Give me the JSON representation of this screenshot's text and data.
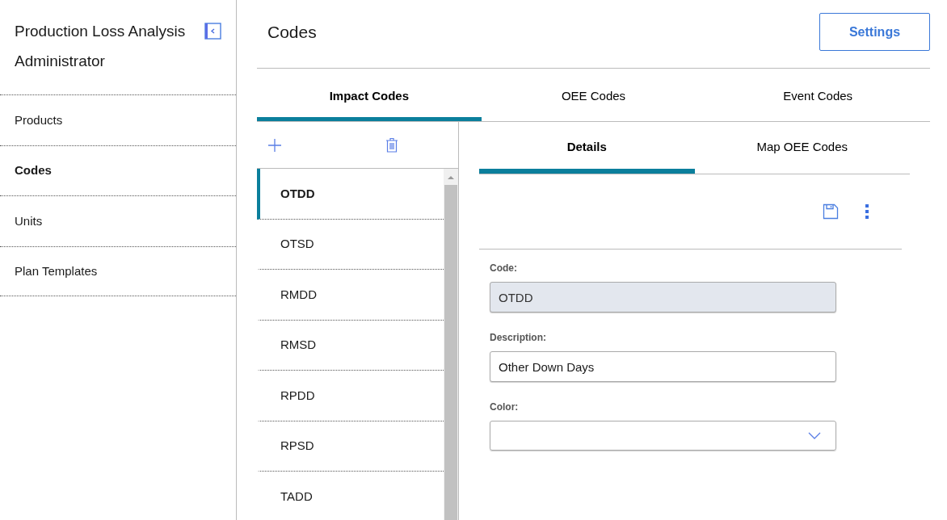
{
  "sidebar": {
    "title": "Production Loss Analysis Administrator",
    "items": [
      {
        "label": "Products",
        "selected": false
      },
      {
        "label": "Codes",
        "selected": true
      },
      {
        "label": "Units",
        "selected": false
      },
      {
        "label": "Plan Templates",
        "selected": false
      }
    ]
  },
  "header": {
    "title": "Codes",
    "settings_button": "Settings"
  },
  "tabs": [
    {
      "label": "Impact Codes",
      "selected": true
    },
    {
      "label": "OEE Codes",
      "selected": false
    },
    {
      "label": "Event Codes",
      "selected": false
    }
  ],
  "codes": [
    {
      "label": "OTDD",
      "selected": true
    },
    {
      "label": "OTSD",
      "selected": false
    },
    {
      "label": "RMDD",
      "selected": false
    },
    {
      "label": "RMSD",
      "selected": false
    },
    {
      "label": "RPDD",
      "selected": false
    },
    {
      "label": "RPSD",
      "selected": false
    },
    {
      "label": "TADD",
      "selected": false
    }
  ],
  "detail_tabs": [
    {
      "label": "Details",
      "selected": true
    },
    {
      "label": "Map OEE Codes",
      "selected": false
    }
  ],
  "fields": [
    {
      "kind": "text",
      "label": "Code:",
      "value": "OTDD",
      "disabled": true
    },
    {
      "kind": "text",
      "label": "Description:",
      "value": "Other Down Days",
      "disabled": false
    },
    {
      "kind": "select",
      "label": "Color:"
    }
  ]
}
